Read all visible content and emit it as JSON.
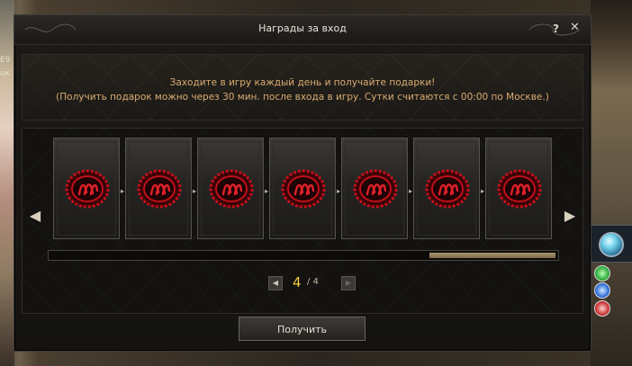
{
  "background": {
    "left_text_1": "E9",
    "left_text_2": "ок"
  },
  "window": {
    "title": "Награды за вход",
    "help_label": "?",
    "close_label": "✕"
  },
  "message": {
    "line1": "Заходите в игру каждый день и получайте подарки!",
    "line2": "(Получить подарок можно через 30 мин. после входа в игру. Сутки считаются с 00:00 по Москве.)"
  },
  "rewards": {
    "card_count": 7,
    "item_icon": "red-seal-icon",
    "progress_fraction": 0.25
  },
  "pager": {
    "current": "4",
    "separator_total": "/ 4"
  },
  "receive_button": "Получить",
  "colors": {
    "message": "#d9ac72",
    "page_current": "#f0c840",
    "seal": "#c0101a"
  }
}
